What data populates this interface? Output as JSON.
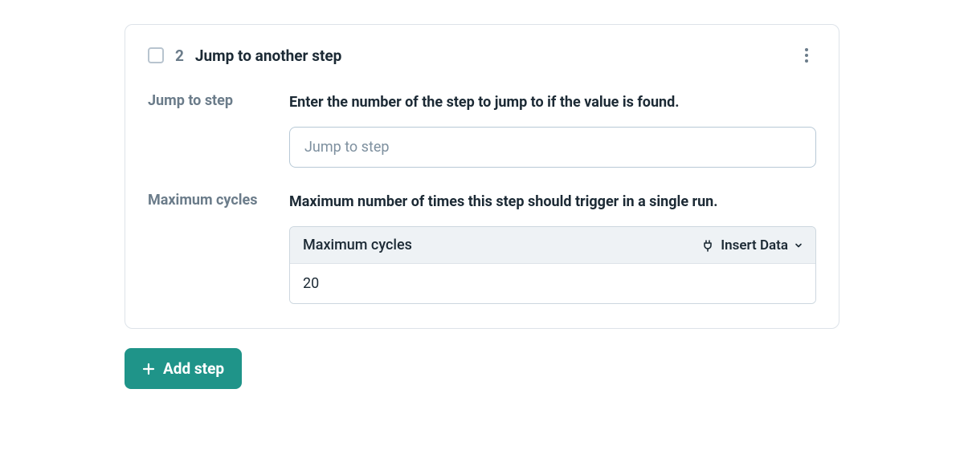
{
  "step": {
    "number": "2",
    "title": "Jump to another step"
  },
  "fields": {
    "jump_to_step": {
      "label": "Jump to step",
      "description": "Enter the number of the step to jump to if the value is found.",
      "placeholder": "Jump to step",
      "value": ""
    },
    "maximum_cycles": {
      "label": "Maximum cycles",
      "description": "Maximum number of times this step should trigger in a single run.",
      "header_label": "Maximum cycles",
      "insert_data_label": "Insert Data",
      "value": "20"
    }
  },
  "buttons": {
    "add_step": "Add step"
  }
}
